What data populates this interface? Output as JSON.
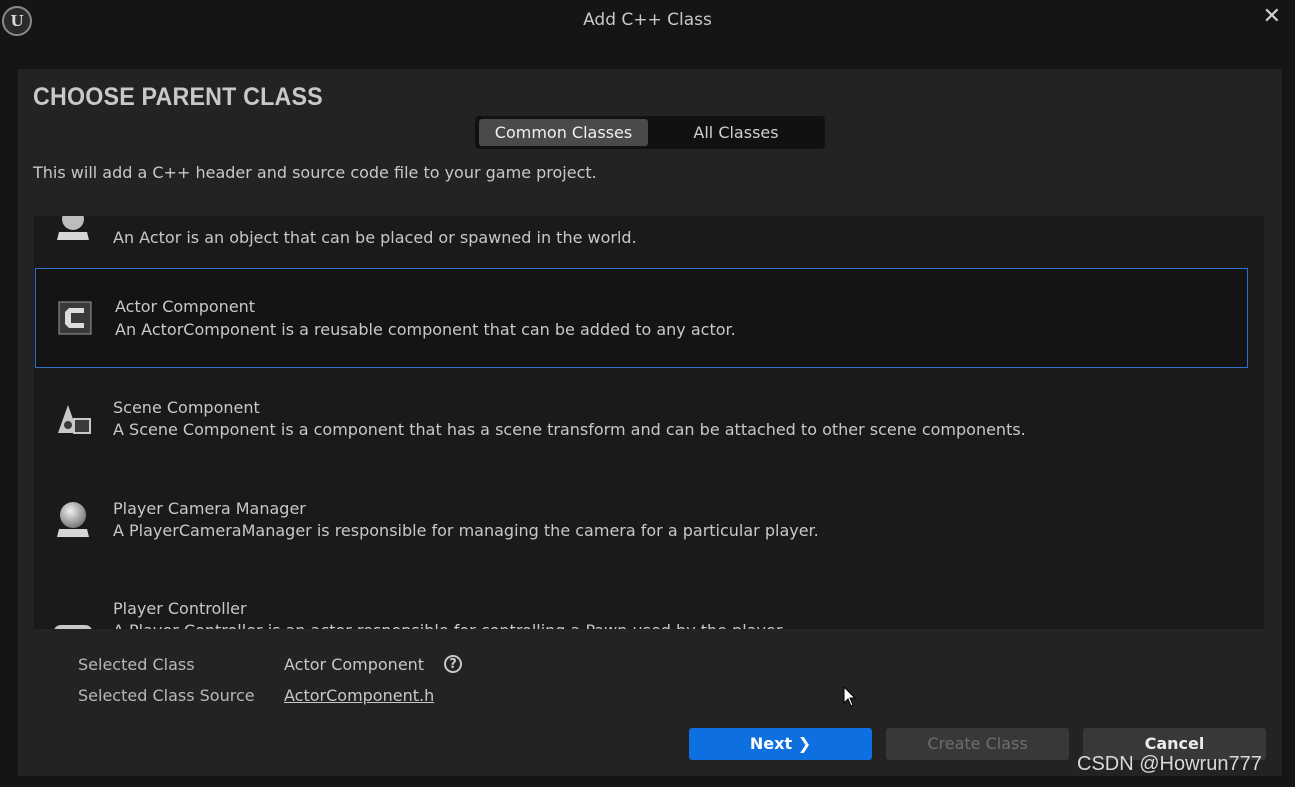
{
  "window": {
    "title": "Add C++ Class",
    "logo_text": "U",
    "close_glyph": "✕"
  },
  "header": {
    "heading": "CHOOSE PARENT CLASS",
    "description": "This will add a C++ header and source code file to your game project."
  },
  "tabs": [
    {
      "label": "Common Classes",
      "active": true
    },
    {
      "label": "All Classes",
      "active": false
    }
  ],
  "class_list": {
    "items": [
      {
        "name": "",
        "description": "An Actor is an object that can be placed or spawned in the world.",
        "icon": "actor-icon",
        "selected": false
      },
      {
        "name": "Actor Component",
        "description": "An ActorComponent is a reusable component that can be added to any actor.",
        "icon": "actor-component-icon",
        "selected": true
      },
      {
        "name": "Scene Component",
        "description": "A Scene Component is a component that has a scene transform and can be attached to other scene components.",
        "icon": "scene-component-icon",
        "selected": false
      },
      {
        "name": "Player Camera Manager",
        "description": "A PlayerCameraManager is responsible for managing the camera for a particular player.",
        "icon": "player-camera-manager-icon",
        "selected": false
      },
      {
        "name": "Player Controller",
        "description": "A Player Controller is an actor responsible for controlling a Pawn used by the player.",
        "icon": "player-controller-icon",
        "selected": false
      }
    ]
  },
  "selection": {
    "class_label": "Selected Class",
    "class_value": "Actor Component",
    "source_label": "Selected Class Source",
    "source_value": "ActorComponent.h",
    "help_glyph": "?"
  },
  "buttons": {
    "next": "Next ❯",
    "create_class": "Create Class",
    "cancel": "Cancel"
  },
  "watermark": "CSDN @Howrun777",
  "colors": {
    "accent": "#0e70e0",
    "selection_border": "#2f6fcf",
    "panel_bg": "#232323",
    "window_bg": "#151515"
  }
}
